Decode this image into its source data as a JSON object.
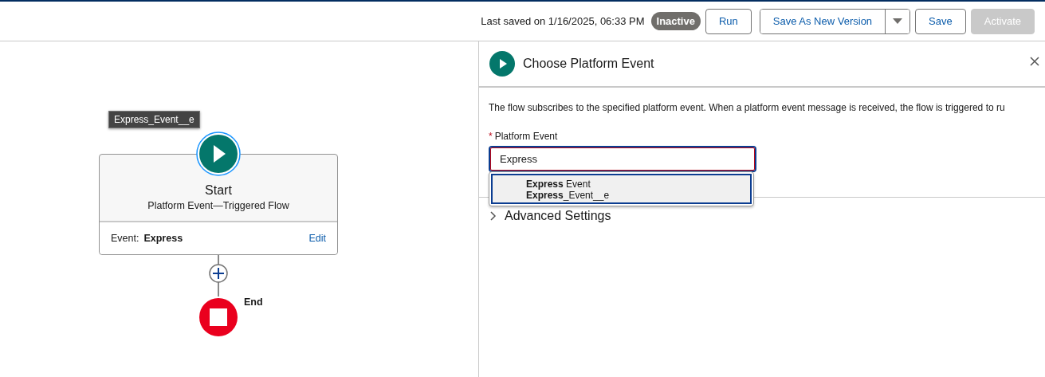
{
  "header": {
    "last_saved": "Last saved on 1/16/2025, 06:33 PM",
    "status": "Inactive",
    "buttons": [
      {
        "label": "Run",
        "kind": "button",
        "disabled": false
      },
      {
        "label": "Save As New Version",
        "kind": "split",
        "disabled": false
      },
      {
        "label": "Save",
        "kind": "button",
        "disabled": false
      },
      {
        "label": "Activate",
        "kind": "button",
        "disabled": true
      }
    ]
  },
  "canvas": {
    "tooltip": "Express_Event__e",
    "start": {
      "title": "Start",
      "subtitle": "Platform Event—Triggered Flow",
      "event_label": "Event:",
      "event_value": "Express",
      "edit": "Edit"
    },
    "end": {
      "label": "End"
    }
  },
  "panel": {
    "title": "Choose Platform Event",
    "description": "The flow subscribes to the specified platform event. When a platform event message is received, the flow is triggered to ru",
    "field": {
      "label": "Platform Event",
      "required_mark": "*",
      "value": "Express",
      "options": [
        {
          "title": "**Express** Event",
          "api_name": "**Express**_Event__e",
          "selected": true
        }
      ]
    },
    "section": {
      "label": "Advanced Settings",
      "expanded": false
    }
  }
}
